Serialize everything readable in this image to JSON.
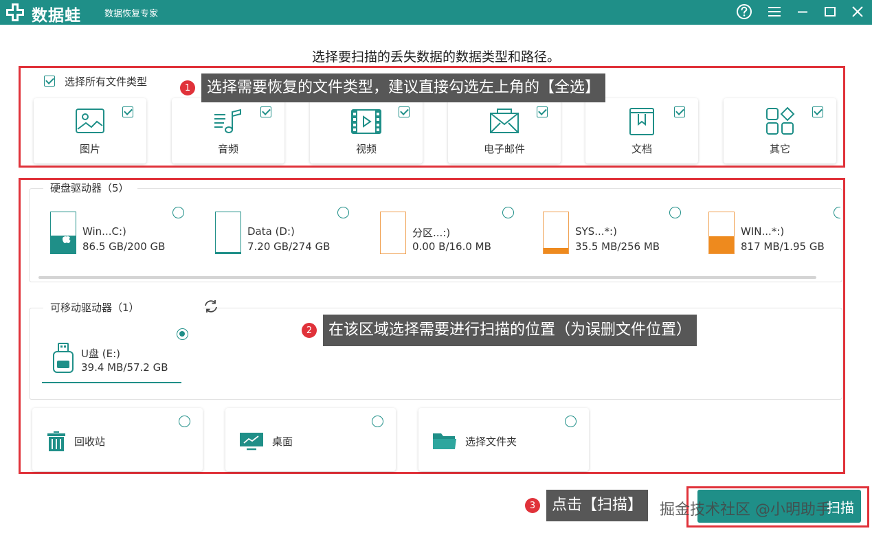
{
  "app": {
    "brand": "数据蛙",
    "subtitle": "数据恢复专家",
    "colors": {
      "accent": "#1f8f88",
      "callout_red": "#e0323a",
      "warning_orange": "#ee8a1e"
    }
  },
  "window_controls": {
    "help": "help-icon",
    "menu": "menu-icon",
    "minimize": "minimize-icon",
    "maximize": "maximize-icon",
    "close": "close-icon"
  },
  "main": {
    "heading": "选择要扫描的丢失数据的数据类型和路径。"
  },
  "file_types": {
    "select_all_label": "选择所有文件类型",
    "select_all_checked": true,
    "items": [
      {
        "label": "图片",
        "icon": "image-icon",
        "checked": true
      },
      {
        "label": "音频",
        "icon": "audio-icon",
        "checked": true
      },
      {
        "label": "视频",
        "icon": "video-icon",
        "checked": true
      },
      {
        "label": "电子邮件",
        "icon": "email-icon",
        "checked": true
      },
      {
        "label": "文档",
        "icon": "document-icon",
        "checked": true
      },
      {
        "label": "其它",
        "icon": "other-icon",
        "checked": true
      }
    ]
  },
  "tips": [
    {
      "num": "1",
      "text": "选择需要恢复的文件类型，建议直接勾选左上角的【全选】"
    },
    {
      "num": "2",
      "text": "在该区域选择需要进行扫描的位置（为误删文件位置）"
    },
    {
      "num": "3",
      "text": "点击【扫描】"
    }
  ],
  "hard_drives": {
    "title": "硬盘驱动器（5）",
    "items": [
      {
        "name": "Win...C:)",
        "size": "86.5 GB/200 GB",
        "used_fraction": 0.43,
        "theme": "teal",
        "selected": false
      },
      {
        "name": "Data (D:)",
        "size": "7.20 GB/274 GB",
        "used_fraction": 0.03,
        "theme": "teal",
        "selected": false
      },
      {
        "name": "分区...:)",
        "size": "0.00  B/16.0 MB",
        "used_fraction": 0.0,
        "theme": "orange",
        "selected": false
      },
      {
        "name": "SYS...*:)",
        "size": "35.5 MB/256 MB",
        "used_fraction": 0.14,
        "theme": "orange",
        "selected": false
      },
      {
        "name": "WIN...*:)",
        "size": "817 MB/1.95 GB",
        "used_fraction": 0.41,
        "theme": "orange",
        "selected": false
      }
    ]
  },
  "removable_drives": {
    "title": "可移动驱动器（1）",
    "refresh_icon": "refresh-icon",
    "items": [
      {
        "name": "U盘 (E:)",
        "size": "39.4 MB/57.2 GB",
        "icon": "usb-drive-icon",
        "selected": true
      }
    ]
  },
  "locations": [
    {
      "label": "回收站",
      "icon": "recycle-bin-icon"
    },
    {
      "label": "桌面",
      "icon": "desktop-icon"
    },
    {
      "label": "选择文件夹",
      "icon": "folder-icon"
    }
  ],
  "actions": {
    "scan_label": "扫描"
  },
  "watermark": "掘金技术社区 @小明助手"
}
